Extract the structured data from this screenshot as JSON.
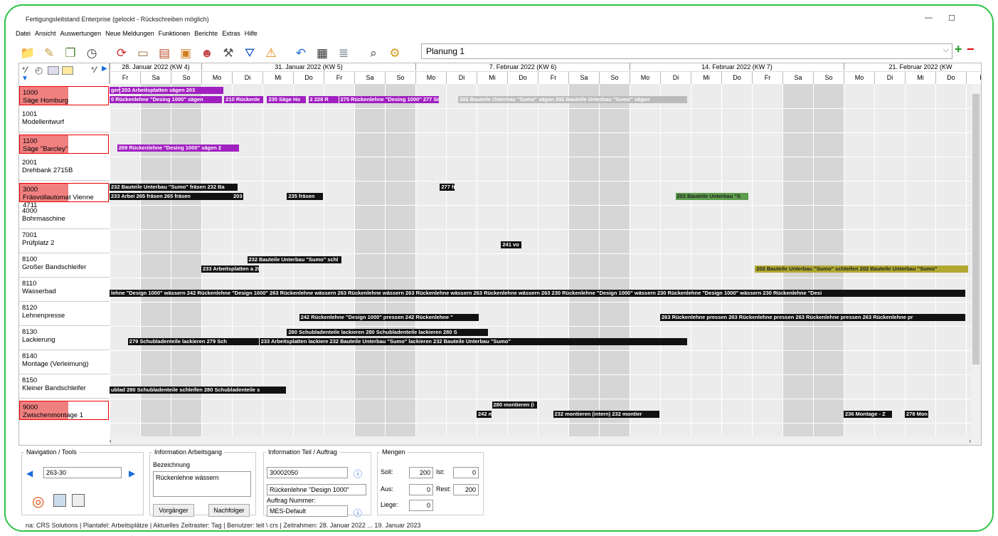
{
  "window": {
    "title": "Fertigungsleitstand Enterprise (gelockt - Rückschreiben möglich)"
  },
  "menu": [
    "Datei",
    "Ansicht",
    "Auswertungen",
    "Neue Meldungen",
    "Funktionen",
    "Berichte",
    "Extras",
    "Hilfe"
  ],
  "toolbar_icons": [
    "new-order-icon",
    "edit-icon",
    "copy-icon",
    "clock-icon",
    "refresh-icon",
    "bed-icon",
    "document-icon",
    "package-icon",
    "users-icon",
    "tools-icon",
    "filter-icon",
    "warning-icon",
    "undo-icon",
    "save-icon",
    "layers-icon",
    "search-icon",
    "settings-icon"
  ],
  "plan_select": {
    "value": "Planung 1"
  },
  "weeks": [
    {
      "label": "28. Januar 2022 (KW 4)"
    },
    {
      "label": "31. Januar 2022 (KW 5)"
    },
    {
      "label": "7. Februar 2022 (KW 6)"
    },
    {
      "label": "14. Februar 2022 (KW 7)"
    },
    {
      "label": "21. Februar 2022 (KW"
    }
  ],
  "days": [
    "Fr",
    "Sa",
    "So",
    "Mo",
    "Di",
    "Mi",
    "Do",
    "Fr",
    "Sa",
    "So",
    "Mo",
    "Di",
    "Mi",
    "Do",
    "Fr",
    "Sa",
    "So",
    "Mo",
    "Di",
    "Mi",
    "Do",
    "Fr",
    "Sa",
    "So",
    "Mo",
    "Di",
    "Mi",
    "Do",
    "F"
  ],
  "resources": [
    {
      "id": "1000",
      "name": "Säge Homburg",
      "highlight": true
    },
    {
      "id": "1001",
      "name": "Modellentwurf",
      "highlight": false
    },
    {
      "id": "1100",
      "name": "Säge \"Barcley\"",
      "highlight": true
    },
    {
      "id": "2001",
      "name": "Drehbank 2715B",
      "highlight": false
    },
    {
      "id": "3000",
      "name": "Fräsvollautomat Vienne 4711",
      "highlight": true
    },
    {
      "id": "4000",
      "name": "Bohrmaschine",
      "highlight": false
    },
    {
      "id": "7001",
      "name": "Prüfplatz 2",
      "highlight": false
    },
    {
      "id": "8100",
      "name": "Großer Bandschleifer",
      "highlight": false
    },
    {
      "id": "8110",
      "name": "Wasserbad",
      "highlight": false
    },
    {
      "id": "8120",
      "name": "Lehnenpresse",
      "highlight": false
    },
    {
      "id": "8130",
      "name": "Lackierung",
      "highlight": false
    },
    {
      "id": "8140",
      "name": "Montage (Verleimung)",
      "highlight": false
    },
    {
      "id": "8150",
      "name": "Kleiner Bandschleifer",
      "highlight": false
    },
    {
      "id": "9000",
      "name": "Zwischenmontage 1",
      "highlight": true
    }
  ],
  "bars": [
    {
      "row": 0,
      "y": 0,
      "start": 0,
      "days": 0.35,
      "color": "purple",
      "text": "gen"
    },
    {
      "row": 0,
      "y": 0,
      "start": 0.35,
      "days": 3.4,
      "color": "purple",
      "text": "203 Arbeitsplatten sägen     203"
    },
    {
      "row": 0,
      "y": 1,
      "start": 0,
      "days": 3.7,
      "color": "purple",
      "text": "0 Rückenlehne \"Desing 1000\" sägen"
    },
    {
      "row": 0,
      "y": 1,
      "start": 3.75,
      "days": 1.3,
      "color": "purple",
      "text": "210 Rückenle"
    },
    {
      "row": 0,
      "y": 1,
      "start": 5.15,
      "days": 1.3,
      "color": "purple",
      "text": "235 Säge Ho"
    },
    {
      "row": 0,
      "y": 1,
      "start": 6.5,
      "days": 1.0,
      "color": "purple",
      "text": "2  228 R"
    },
    {
      "row": 0,
      "y": 1,
      "start": 7.5,
      "days": 3.3,
      "color": "purple",
      "text": "275 Rückenlehne \"Desing 1000\"   277 Sä"
    },
    {
      "row": 0,
      "y": 1,
      "start": 11.4,
      "days": 7.5,
      "color": "gray",
      "text": "202 Bauteile Unterbau \"Sumo\" sägen      202 Bauteile Unterbau \"Sumo\" sägen"
    },
    {
      "row": 2,
      "y": 1,
      "start": 0.25,
      "days": 4.0,
      "color": "purple",
      "text": "269 Rückenlehne \"Desing 1000\" sägen     2"
    },
    {
      "row": 4,
      "y": 0,
      "start": 0,
      "days": 4.2,
      "color": "black",
      "text": "232 Bauteile Unterbau \"Sumo\" fräsen     232 Ba"
    },
    {
      "row": 4,
      "y": 1,
      "start": 0,
      "days": 4.2,
      "color": "black",
      "text": "233 Arbei 265 fräsen    265 fräsen"
    },
    {
      "row": 4,
      "y": 1,
      "start": 4.0,
      "days": 0.4,
      "color": "black",
      "text": "203"
    },
    {
      "row": 4,
      "y": 1,
      "start": 5.8,
      "days": 1.2,
      "color": "black",
      "text": "235 fräsen"
    },
    {
      "row": 4,
      "y": 0,
      "start": 10.8,
      "days": 0.5,
      "color": "black",
      "text": "277 fr"
    },
    {
      "row": 4,
      "y": 1,
      "start": 18.5,
      "days": 2.4,
      "color": "green",
      "text": "202 Bauteile Unterbau \"S"
    },
    {
      "row": 6,
      "y": 1,
      "start": 12.8,
      "days": 0.7,
      "color": "black",
      "text": "241 vo"
    },
    {
      "row": 7,
      "y": 0,
      "start": 4.5,
      "days": 3.1,
      "color": "black",
      "text": "232 Bauteile Unterbau \"Sumo\" schl"
    },
    {
      "row": 7,
      "y": 1,
      "start": 3.0,
      "days": 1.9,
      "color": "black",
      "text": "233 Arbeitsplatten a 203 Arb"
    },
    {
      "row": 7,
      "y": 1,
      "start": 21.1,
      "days": 7.0,
      "color": "olive",
      "text": "202 Bauteile Unterbau \"Sumo\" schleifen    202 Bauteile Unterbau \"Sumo\""
    },
    {
      "row": 8,
      "y": 1,
      "start": 0,
      "days": 28,
      "color": "black",
      "text": "lehne \"Design 1000\" wässern     242 Rückenlehne \"Design 1000\"  263 Rückenlehne wässern     263 Rückenlehne wässern     263 Rückenlehne wässern     263 Rückenlehne wässern     263  230 Rückenlehne \"Design 1000\" wässern     230 Rückenlehne \"Design 1000\" wässern     230 Rückenlehne \"Desi"
    },
    {
      "row": 9,
      "y": 1,
      "start": 6.2,
      "days": 5.9,
      "color": "black",
      "text": "242 Rückenlehne \"Design 1000\" pressen    242 Rückenlehne \""
    },
    {
      "row": 9,
      "y": 1,
      "start": 18.0,
      "days": 10,
      "color": "black",
      "text": "263 Rückenlehne pressen    263 Rückenlehne pressen    263 Rückenlehne pressen    263 Rückenlehne pr"
    },
    {
      "row": 10,
      "y": 0,
      "start": 5.8,
      "days": 6.6,
      "color": "black",
      "text": "280 Schubladenteile lackieren     280 Schubladenteile lackieren     280 S"
    },
    {
      "row": 10,
      "y": 1,
      "start": 0.6,
      "days": 4.3,
      "color": "black",
      "text": "279 Schubladenteile lackieren     279 Sch"
    },
    {
      "row": 10,
      "y": 1,
      "start": 4.9,
      "days": 14,
      "color": "black",
      "text": "233 Arbeitsplatten lackiere  232 Bauteile Unterbau \"Sumo\" lackieren     232 Bauteile Unterbau \"Sumo\""
    },
    {
      "row": 12,
      "y": 1,
      "start": 0,
      "days": 5.8,
      "color": "black",
      "text": "ublad 280 Schubladenteile schleifen     280 Schubladenteile s"
    },
    {
      "row": 13,
      "y": 0,
      "start": 12.5,
      "days": 1.5,
      "color": "black",
      "text": "280 montieren (i"
    },
    {
      "row": 13,
      "y": 1,
      "start": 12.0,
      "days": 0.5,
      "color": "black",
      "text": "242 m"
    },
    {
      "row": 13,
      "y": 1,
      "start": 14.5,
      "days": 3.5,
      "color": "black",
      "text": "232 montieren (intern)     232 montier"
    },
    {
      "row": 13,
      "y": 1,
      "start": 24.0,
      "days": 1.6,
      "color": "black",
      "text": "236 Montage - Z"
    },
    {
      "row": 13,
      "y": 1,
      "start": 26.0,
      "days": 0.8,
      "color": "black",
      "text": "278 Mon"
    }
  ],
  "nav": {
    "legend": "Navigation / Tools",
    "value": "263-30"
  },
  "ag": {
    "legend": "Information Arbeitsgang",
    "sub": "Bezeichnung",
    "text": "Rückenlehne wässern",
    "prev": "Vorgänger",
    "next": "Nachfolger"
  },
  "teil": {
    "legend": "Information Teil / Auftrag",
    "number": "30002050",
    "name": "Rückenlehne \"Design 1000\"",
    "auftrag_label": "Auftrag Nummer:",
    "auftrag": "MES-Default"
  },
  "mengen": {
    "legend": "Mengen",
    "soll_label": "Soll:",
    "soll": "200",
    "ist_label": "Ist:",
    "ist": "0",
    "aus_label": "Aus:",
    "aus": "0",
    "rest_label": "Rest:",
    "rest": "200",
    "liege_label": "Liege:",
    "liege": "0"
  },
  "status": "na: CRS Solutions   |   Plantafel: Arbeitsplätze   |   Aktuelles Zeitraster: Tag   |   Benutzer: leit \\ crs   |   Zeitrahmen: 28. Januar 2022 ... 19. Januar 2023"
}
